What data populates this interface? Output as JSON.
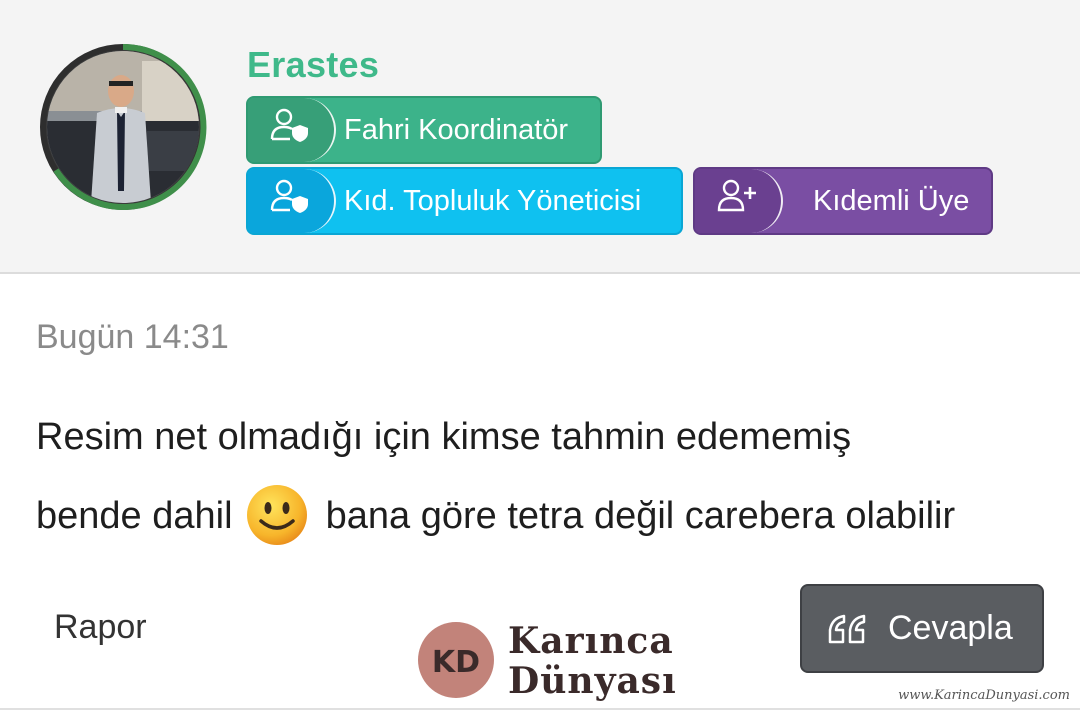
{
  "user": {
    "name": "Erastes",
    "badges": [
      {
        "label": "Fahri Koordinatör",
        "icon": "user-shield-icon",
        "color": "#3cb38a"
      },
      {
        "label": "Kıd. Topluluk Yöneticisi",
        "icon": "user-shield-icon",
        "color": "#0fc1f0"
      },
      {
        "label": "Kıdemli Üye",
        "icon": "user-plus-icon",
        "color": "#7a4ea3"
      }
    ]
  },
  "post": {
    "timestamp": "Bugün 14:31",
    "line1": "Resim net olmadığı için kimse tahmin edememiş",
    "line2_before": "bende dahil",
    "line2_after": "bana göre tetra değil carebera olabilir",
    "emoji": "smiley-emoji"
  },
  "actions": {
    "report_label": "Rapor",
    "reply_label": "Cevapla",
    "reply_icon": "quote-icon"
  },
  "branding": {
    "logo_line1": "Karınca",
    "logo_line2": "Dünyası",
    "logo_mark": "KD",
    "watermark": "www.KarincaDunyasi.com"
  }
}
